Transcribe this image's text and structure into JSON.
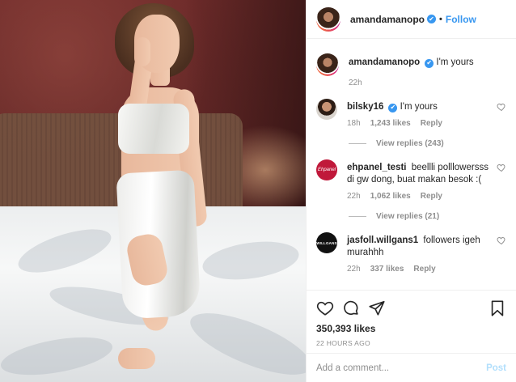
{
  "post": {
    "author": "amandamanopo",
    "follow_label": "Follow",
    "dot": "•",
    "verified_mark": "✔",
    "caption": {
      "username": "amandamanopo",
      "text": "I'm yours",
      "age": "22h"
    },
    "comments": [
      {
        "username": "bilsky16",
        "verified": true,
        "text": "I'm yours",
        "age": "18h",
        "likes": "1,243 likes",
        "reply": "Reply",
        "view_replies": "View replies (243)"
      },
      {
        "username": "ehpanel_testi",
        "verified": false,
        "text": "beellli polllowersss di gw dong, buat makan besok :(",
        "age": "22h",
        "likes": "1,062 likes",
        "reply": "Reply",
        "view_replies": "View replies (21)",
        "avatar_text": "Ehpanel"
      },
      {
        "username": "jasfoll.willgans1",
        "verified": false,
        "text": "followers igeh murahhh",
        "age": "22h",
        "likes": "337 likes",
        "reply": "Reply",
        "avatar_text": "WILLGANS"
      }
    ],
    "likes_total": "350,393 likes",
    "posted_ago": "22 HOURS AGO",
    "add_comment_placeholder": "Add a comment...",
    "post_button": "Post",
    "icons": [
      "heart-icon",
      "comment-icon",
      "share-icon",
      "bookmark-icon"
    ],
    "colors": {
      "accent": "#3897f0",
      "post_button_disabled": "#b2dffc",
      "muted_text": "#8e8e8e"
    }
  }
}
